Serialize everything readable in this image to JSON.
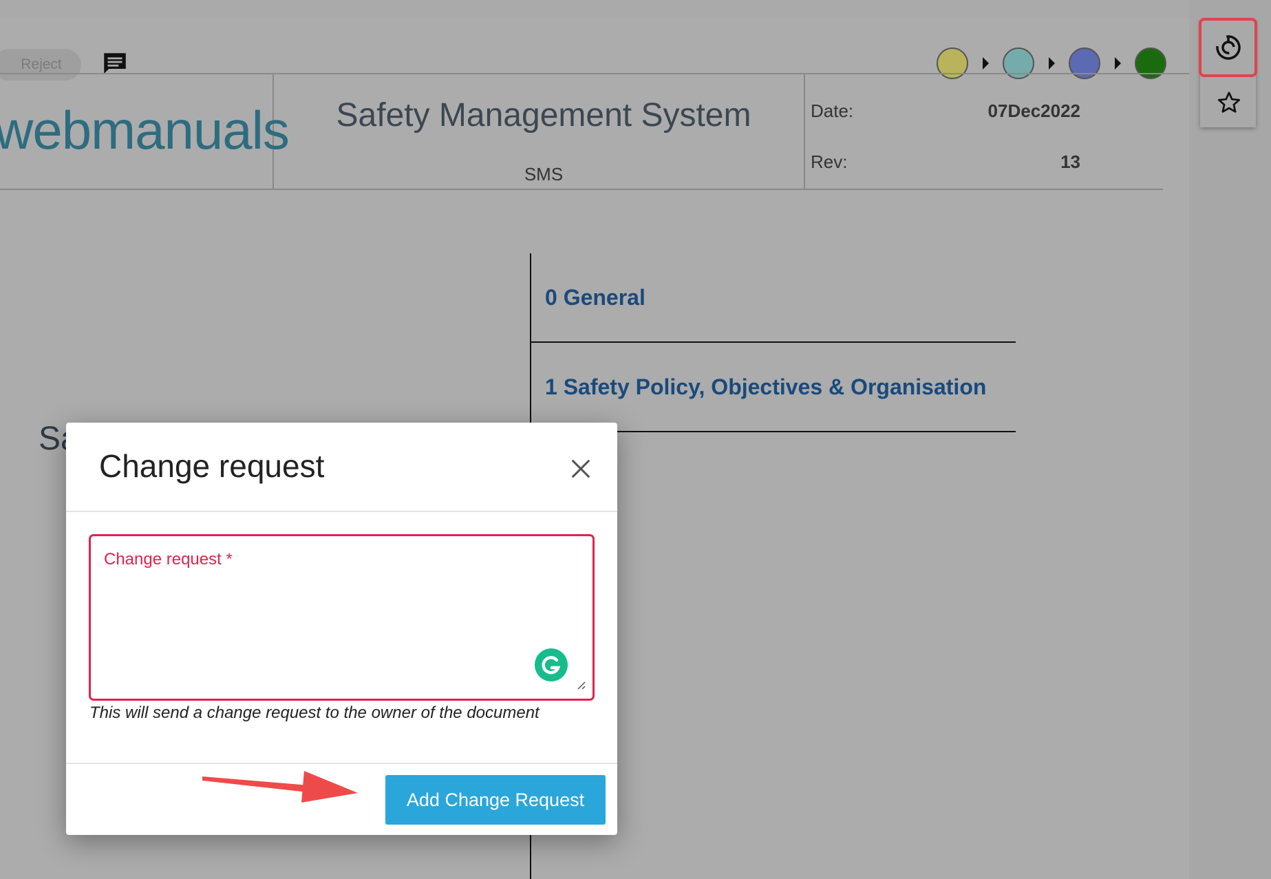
{
  "toolbar": {
    "reject_label": "Reject",
    "status_dots": [
      {
        "name": "status-yellow",
        "color": "#b9b45b"
      },
      {
        "name": "status-teal",
        "color": "#75acab"
      },
      {
        "name": "status-blue",
        "color": "#5b6ab3"
      },
      {
        "name": "status-green",
        "color": "#1a6b0d"
      }
    ]
  },
  "header": {
    "logo": "webmanuals",
    "title": "Safety Management System",
    "subtitle": "SMS",
    "date_label": "Date:",
    "date_value": "07Dec2022",
    "rev_label": "Rev:",
    "rev_value": "13"
  },
  "toc": {
    "items": [
      "0 General",
      "1 Safety Policy, Objectives & Organisation"
    ]
  },
  "partial_title": "Sa",
  "modal": {
    "title": "Change request",
    "field_label": "Change request *",
    "helper_text": "This will send a change request to the owner of the document",
    "submit_label": "Add Change Request"
  },
  "colors": {
    "accent_button": "#2aa6db",
    "error_red": "#e3214f",
    "highlight_red": "#e0444d"
  }
}
